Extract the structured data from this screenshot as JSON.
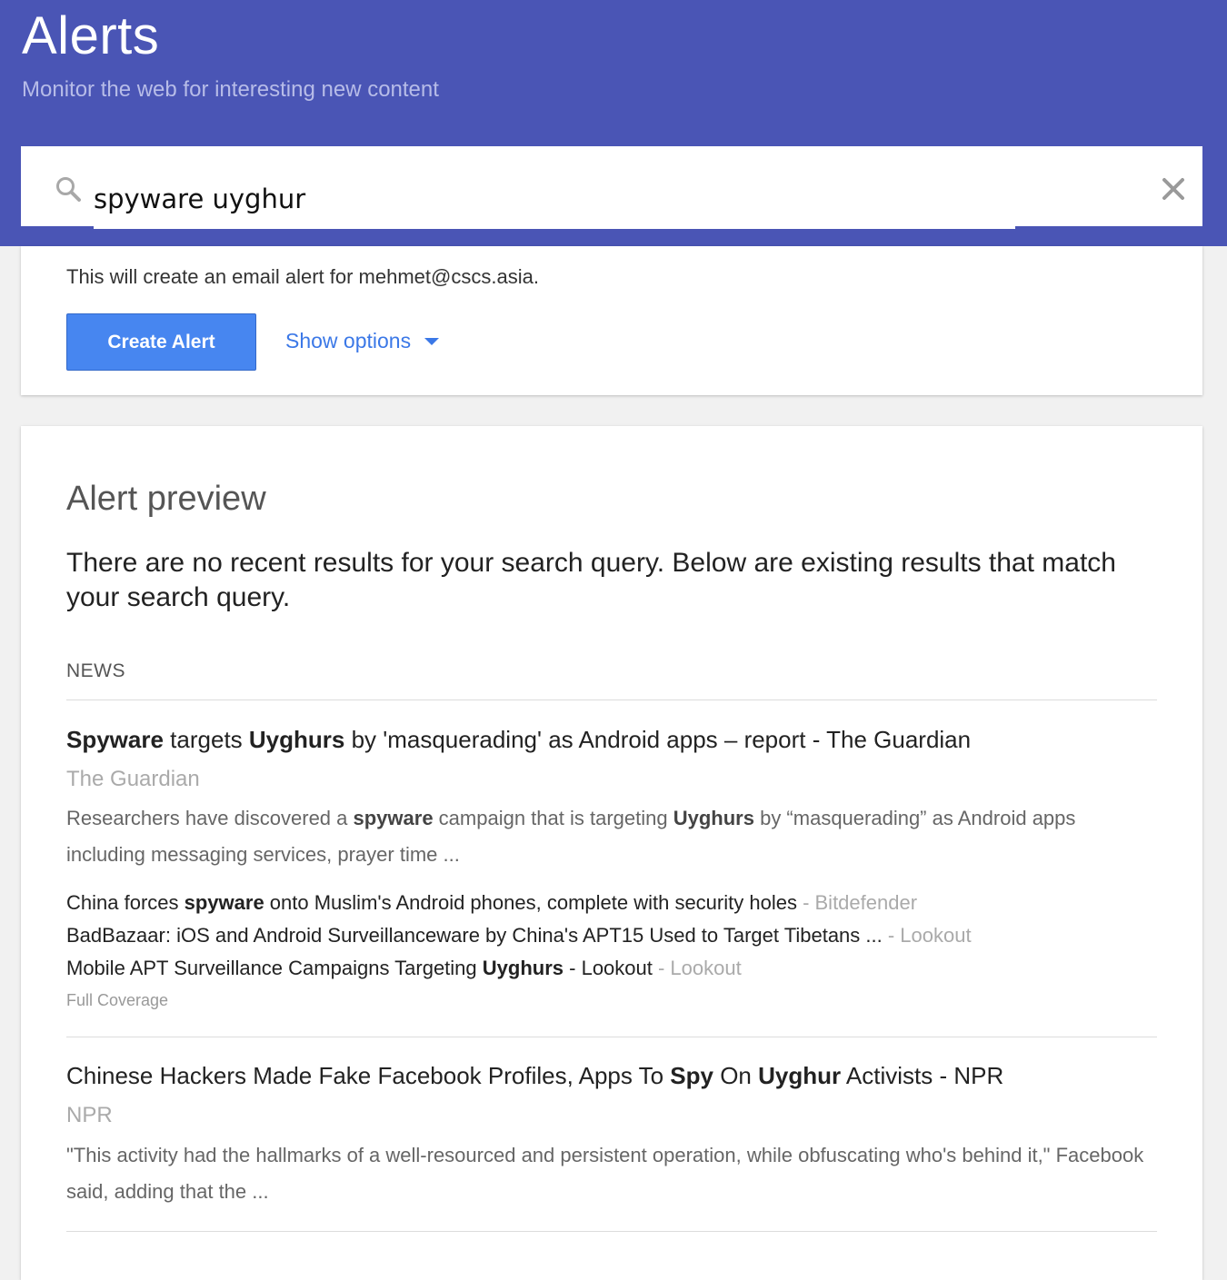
{
  "header": {
    "title": "Alerts",
    "subtitle": "Monitor the web for interesting new content"
  },
  "search": {
    "value": "spyware uyghur",
    "icon": "search-icon",
    "clear_icon": "close-icon"
  },
  "create_card": {
    "email_note": "This will create an email alert for mehmet@cscs.asia.",
    "create_button_label": "Create Alert",
    "show_options_label": "Show options"
  },
  "preview": {
    "title": "Alert preview",
    "message": "There are no recent results for your search query. Below are existing results that match your search query.",
    "section_label": "NEWS",
    "results": [
      {
        "title_parts": [
          {
            "text": "Spyware",
            "bold": true
          },
          {
            "text": " targets ",
            "bold": false
          },
          {
            "text": "Uyghurs",
            "bold": true
          },
          {
            "text": " by 'masquerading' as Android apps – report - The Guardian",
            "bold": false
          }
        ],
        "source": "The Guardian",
        "snippet_parts": [
          {
            "text": "Researchers have discovered a ",
            "bold": false
          },
          {
            "text": "spyware",
            "bold": true
          },
          {
            "text": " campaign that is targeting ",
            "bold": false
          },
          {
            "text": "Uyghurs",
            "bold": true
          },
          {
            "text": " by “masquerading” as Android apps including messaging services, prayer time ...",
            "bold": false
          }
        ],
        "related": [
          {
            "parts": [
              {
                "text": "China forces ",
                "bold": false
              },
              {
                "text": "spyware",
                "bold": true
              },
              {
                "text": " onto Muslim's Android phones, complete with security holes",
                "bold": false
              }
            ],
            "source": " - Bitdefender"
          },
          {
            "parts": [
              {
                "text": "BadBazaar: iOS and Android Surveillanceware by China's APT15 Used to Target Tibetans ...",
                "bold": false
              }
            ],
            "source": " - Lookout"
          },
          {
            "parts": [
              {
                "text": "Mobile APT Surveillance Campaigns Targeting ",
                "bold": false
              },
              {
                "text": "Uyghurs",
                "bold": true
              },
              {
                "text": " - Lookout",
                "bold": false
              }
            ],
            "source": " - Lookout"
          }
        ],
        "full_coverage_label": "Full Coverage"
      },
      {
        "title_parts": [
          {
            "text": "Chinese Hackers Made Fake Facebook Profiles, Apps To ",
            "bold": false
          },
          {
            "text": "Spy",
            "bold": true
          },
          {
            "text": " On ",
            "bold": false
          },
          {
            "text": "Uyghur",
            "bold": true
          },
          {
            "text": " Activists - NPR",
            "bold": false
          }
        ],
        "source": "NPR",
        "snippet_parts": [
          {
            "text": "\"This activity had the hallmarks of a well-resourced and persistent operation, while obfuscating who's behind it,\" Facebook said, adding that the ...",
            "bold": false
          }
        ]
      }
    ]
  }
}
